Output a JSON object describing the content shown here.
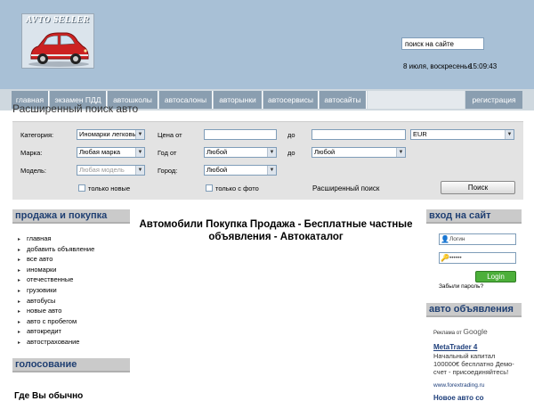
{
  "header": {
    "logo_text": "AVTO SELLER",
    "search_value": "поиск на сайте",
    "date": "8 июля, воскресенье",
    "time": "15:09:43"
  },
  "nav": {
    "items": [
      "главная",
      "экзамен ПДД",
      "автошколы",
      "автосалоны",
      "авторынки",
      "автосервисы",
      "автосайты"
    ],
    "register": "регистрация"
  },
  "search": {
    "title": "Расширенный поиск авто",
    "category_label": "Категория:",
    "category_value": "Иномарки легковы",
    "price_from_label": "Цена от",
    "price_to_label": "до",
    "currency_value": "EUR",
    "brand_label": "Марка:",
    "brand_value": "Любая марка",
    "year_from_label": "Год от",
    "year_from_value": "Любой",
    "year_to_label": "до",
    "year_to_value": "Любой",
    "model_label": "Модель:",
    "model_value": "Любая модель",
    "city_label": "Город:",
    "city_value": "Любой",
    "only_new_label": "только новые",
    "with_photo_label": "только с фото",
    "advanced_link": "Расширенный поиск",
    "search_button": "Поиск"
  },
  "left": {
    "sales_heading": "продажа и покупка",
    "menu": [
      "главная",
      "добавить объявление",
      "все авто",
      "иномарки",
      "отечественные",
      "грузовики",
      "автобусы",
      "новые авто",
      "авто с пробегом",
      "автокредит",
      "автострахование"
    ],
    "poll_heading": "голосование",
    "poll_question": "Где Вы обычно"
  },
  "main": {
    "title": "Автомобили Покупка Продажа - Бесплатные частные объявления - Автокаталог"
  },
  "right": {
    "login_heading": "вход на сайт",
    "login_placeholder": "Логин",
    "password_mask": "••••••",
    "login_button": "Login",
    "forgot_link": "Забыли пароль?",
    "ads_heading": "авто объявления",
    "ads_label": "Реклама от",
    "ads_google": "Google",
    "ad1_title": "MetaTrader 4",
    "ad1_text": "Начальный капитал 100000€ бесплатно Демо-счет - присоединяйтесь!",
    "ad1_url": "www.forextrading.ru",
    "ad2_title": "Новое авто со"
  },
  "colors": {
    "header_bg": "#a8c0d6",
    "nav_bg": "#8a9eb0",
    "heading_text": "#1f3f72",
    "login_button": "#4caf3a"
  }
}
